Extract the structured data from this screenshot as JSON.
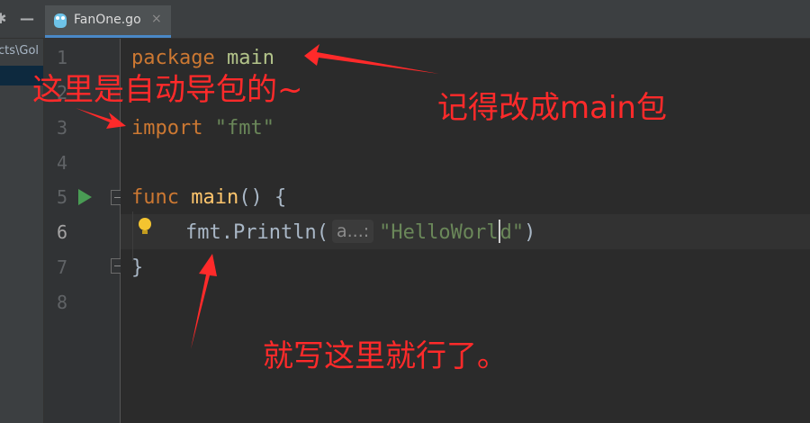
{
  "tabbar": {
    "active_tab": {
      "label": "FanOne.go",
      "close": "×",
      "icon": "gopher-icon"
    },
    "gear_icon": "✱",
    "minimize_icon": "—"
  },
  "project": {
    "path_text": "cts\\Gol"
  },
  "gutter": {
    "line_numbers": [
      "1",
      "2",
      "3",
      "4",
      "5",
      "6",
      "7",
      "8"
    ],
    "current_line": "6",
    "run_icon": "run-icon",
    "fold_icon": "fold-icon"
  },
  "editor": {
    "line1": {
      "keyword": "package",
      "name": "main"
    },
    "line3": {
      "keyword": "import",
      "path": "\"fmt\""
    },
    "line5": {
      "keyword": "func",
      "name": "main",
      "rest": "() {"
    },
    "line6": {
      "pkg": "fmt",
      "dot": ".",
      "call": "Println(",
      "hint": "a...:",
      "arg_before_cursor": "\"HelloWorl",
      "arg_after_cursor": "d\"",
      "close": ")"
    },
    "line7": {
      "text": "}"
    }
  },
  "annotations": {
    "auto_import": "这里是自动导包的~",
    "change_main": "记得改成main包",
    "write_here": "就写这里就行了。"
  },
  "colors": {
    "annotation": "#ff2a2a",
    "keyword": "#cc7832",
    "string": "#6a8759",
    "function": "#ffc66d",
    "run": "#499c54"
  }
}
